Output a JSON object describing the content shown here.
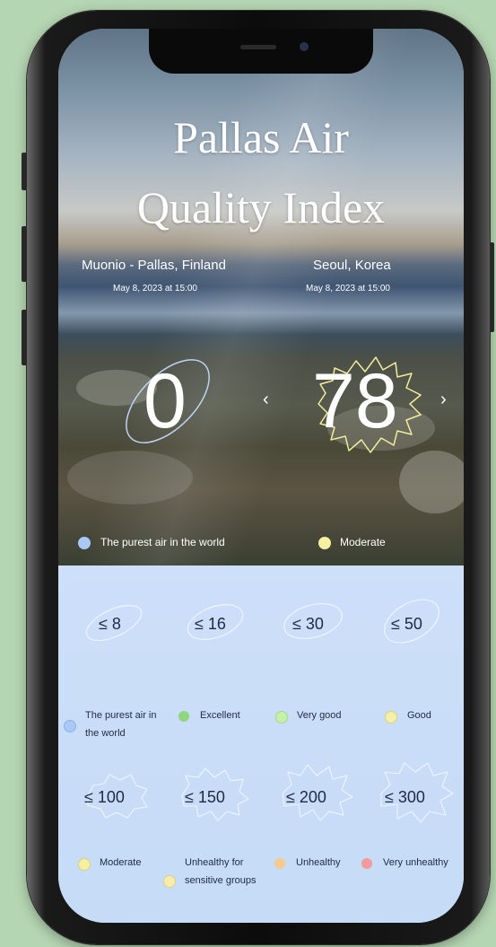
{
  "header": {
    "title_line1": "Pallas Air",
    "title_line2": "Quality Index"
  },
  "locations": [
    {
      "name": "Muonio - Pallas, Finland",
      "date": "May 8, 2023 at 15:00",
      "value": "0",
      "status": "The purest air in the world",
      "color": "#a9c8f5"
    },
    {
      "name": "Seoul, Korea",
      "date": "May 8, 2023 at 15:00",
      "value": "78",
      "status": "Moderate",
      "color": "#f6f0a0"
    }
  ],
  "nav": {
    "prev": "‹",
    "next": "›",
    "prev_icon": "chevron-left-icon",
    "next_icon": "chevron-right-icon"
  },
  "scale": [
    {
      "threshold": "≤ 8",
      "label": "The purest air in the world",
      "color": "#a9c8f5"
    },
    {
      "threshold": "≤ 16",
      "label": "Excellent",
      "color": "#8fd67f"
    },
    {
      "threshold": "≤ 30",
      "label": "Very good",
      "color": "#c5f0a8"
    },
    {
      "threshold": "≤ 50",
      "label": "Good",
      "color": "#f4f0a8"
    },
    {
      "threshold": "≤ 100",
      "label": "Moderate",
      "color": "#f6f0a0"
    },
    {
      "threshold": "≤ 150",
      "label": "Unhealthy for sensitive groups",
      "color": "#f8ecaa"
    },
    {
      "threshold": "≤ 200",
      "label": "Unhealthy",
      "color": "#f5c98f"
    },
    {
      "threshold": "≤ 300",
      "label": "Very unhealthy",
      "color": "#f49a9a"
    }
  ]
}
